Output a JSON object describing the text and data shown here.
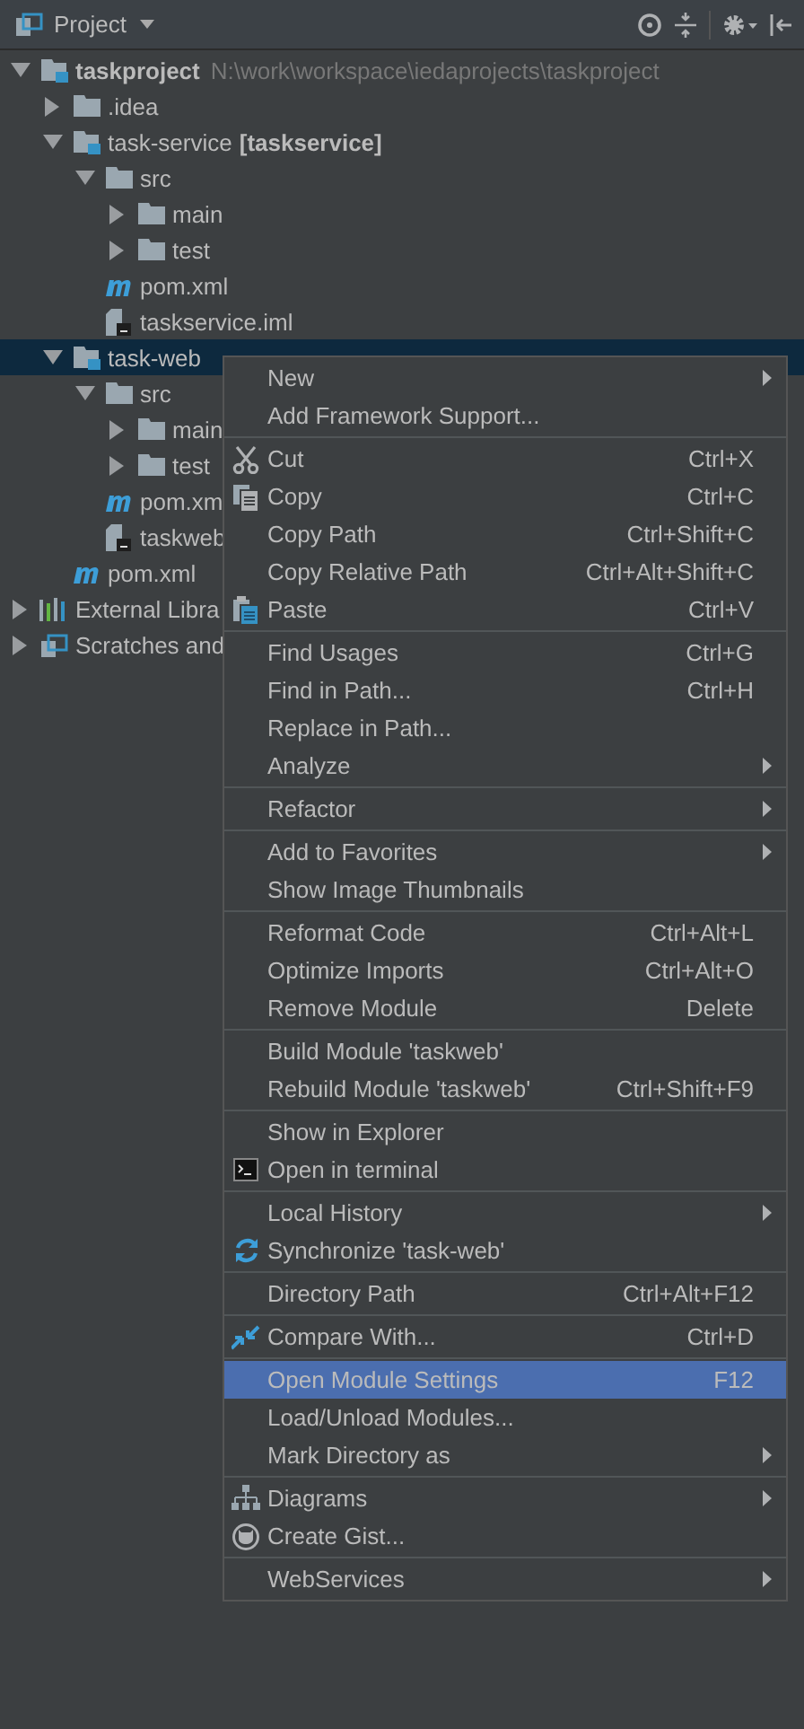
{
  "panel": {
    "title": "Project"
  },
  "tree": [
    {
      "label": "taskproject",
      "bold": true,
      "path": "N:\\work\\workspace\\iedaprojects\\taskproject",
      "kind": "module",
      "expanded": true,
      "selected": false,
      "children": [
        {
          "label": ".idea",
          "kind": "folder",
          "expanded": false,
          "selected": false
        },
        {
          "label": "task-service",
          "suffix": "[taskservice]",
          "kind": "module",
          "expanded": true,
          "selected": false,
          "children": [
            {
              "label": "src",
              "kind": "folder",
              "expanded": true,
              "selected": false,
              "children": [
                {
                  "label": "main",
                  "kind": "folder",
                  "expanded": false,
                  "selected": false
                },
                {
                  "label": "test",
                  "kind": "folder",
                  "expanded": false,
                  "selected": false
                }
              ]
            },
            {
              "label": "pom.xml",
              "kind": "maven",
              "selected": false
            },
            {
              "label": "taskservice.iml",
              "kind": "iml",
              "selected": false
            }
          ]
        },
        {
          "label": "task-web",
          "kind": "module",
          "expanded": true,
          "selected": true,
          "children": [
            {
              "label": "src",
              "kind": "folder",
              "expanded": true,
              "selected": false,
              "children": [
                {
                  "label": "main",
                  "kind": "folder",
                  "expanded": false,
                  "selected": false
                },
                {
                  "label": "test",
                  "kind": "folder",
                  "expanded": false,
                  "selected": false
                }
              ]
            },
            {
              "label": "pom.xm",
              "kind": "maven",
              "selected": false
            },
            {
              "label": "taskweb",
              "kind": "iml",
              "selected": false
            }
          ]
        },
        {
          "label": "pom.xml",
          "kind": "maven",
          "selected": false
        }
      ]
    },
    {
      "label": "External Libra",
      "kind": "libraries",
      "expanded": false,
      "selected": false
    },
    {
      "label": "Scratches and",
      "kind": "scratches",
      "expanded": false,
      "selected": false
    }
  ],
  "context_menu": {
    "groups": [
      [
        {
          "label": "New",
          "submenu": true,
          "selected": false
        },
        {
          "label": "Add Framework Support...",
          "selected": false
        }
      ],
      [
        {
          "label": "Cut",
          "shortcut": "Ctrl+X",
          "kind": "cut",
          "selected": false
        },
        {
          "label": "Copy",
          "shortcut": "Ctrl+C",
          "kind": "copy",
          "selected": false
        },
        {
          "label": "Copy Path",
          "shortcut": "Ctrl+Shift+C",
          "selected": false
        },
        {
          "label": "Copy Relative Path",
          "shortcut": "Ctrl+Alt+Shift+C",
          "selected": false
        },
        {
          "label": "Paste",
          "shortcut": "Ctrl+V",
          "kind": "paste",
          "selected": false
        }
      ],
      [
        {
          "label": "Find Usages",
          "shortcut": "Ctrl+G",
          "selected": false
        },
        {
          "label": "Find in Path...",
          "shortcut": "Ctrl+H",
          "selected": false
        },
        {
          "label": "Replace in Path...",
          "selected": false
        },
        {
          "label": "Analyze",
          "submenu": true,
          "selected": false
        }
      ],
      [
        {
          "label": "Refactor",
          "submenu": true,
          "selected": false
        }
      ],
      [
        {
          "label": "Add to Favorites",
          "submenu": true,
          "selected": false
        },
        {
          "label": "Show Image Thumbnails",
          "selected": false
        }
      ],
      [
        {
          "label": "Reformat Code",
          "shortcut": "Ctrl+Alt+L",
          "selected": false
        },
        {
          "label": "Optimize Imports",
          "shortcut": "Ctrl+Alt+O",
          "selected": false
        },
        {
          "label": "Remove Module",
          "shortcut": "Delete",
          "selected": false
        }
      ],
      [
        {
          "label": "Build Module 'taskweb'",
          "selected": false
        },
        {
          "label": "Rebuild Module 'taskweb'",
          "shortcut": "Ctrl+Shift+F9",
          "selected": false
        }
      ],
      [
        {
          "label": "Show in Explorer",
          "selected": false
        },
        {
          "label": "Open in terminal",
          "kind": "terminal",
          "selected": false
        }
      ],
      [
        {
          "label": "Local History",
          "submenu": true,
          "selected": false
        },
        {
          "label": "Synchronize 'task-web'",
          "kind": "sync",
          "selected": false
        }
      ],
      [
        {
          "label": "Directory Path",
          "shortcut": "Ctrl+Alt+F12",
          "selected": false
        }
      ],
      [
        {
          "label": "Compare With...",
          "shortcut": "Ctrl+D",
          "kind": "compare",
          "selected": false
        }
      ],
      [
        {
          "label": "Open Module Settings",
          "shortcut": "F12",
          "selected": true
        },
        {
          "label": "Load/Unload Modules...",
          "selected": false
        },
        {
          "label": "Mark Directory as",
          "submenu": true,
          "selected": false
        }
      ],
      [
        {
          "label": "Diagrams",
          "submenu": true,
          "kind": "diagram",
          "selected": false
        },
        {
          "label": "Create Gist...",
          "kind": "gist",
          "selected": false
        }
      ],
      [
        {
          "label": "WebServices",
          "submenu": true,
          "selected": false
        }
      ]
    ]
  }
}
